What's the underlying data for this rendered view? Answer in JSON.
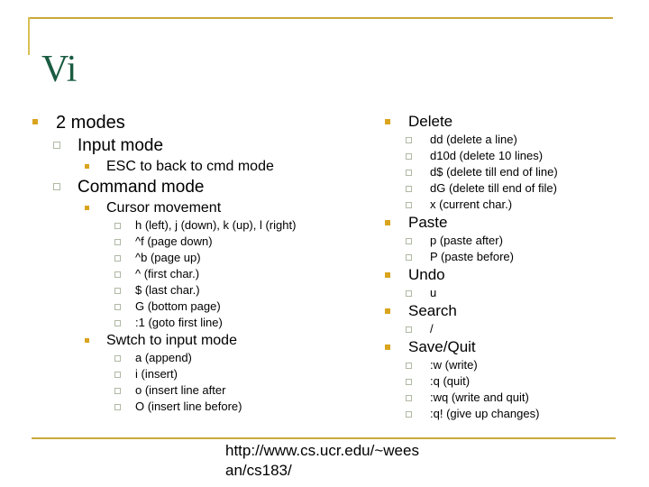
{
  "slide": {
    "title": "Vi",
    "title_color": "#1a5c42",
    "accent_color": "#c9a93a",
    "bullet_filled_color": "#d9a41e",
    "bullet_hollow_border_color": "#aeb9a4",
    "background_color": "#ffffff"
  },
  "left_column": [
    {
      "level": 1,
      "bullet": "filled-square",
      "text": "2 modes"
    },
    {
      "level": 2,
      "bullet": "hollow-square",
      "text": "Input mode"
    },
    {
      "level": 3,
      "bullet": "filled-square",
      "text": "ESC to back to cmd mode"
    },
    {
      "level": 2,
      "bullet": "hollow-square",
      "text": "Command mode"
    },
    {
      "level": 3,
      "bullet": "filled-square",
      "text": "Cursor movement"
    },
    {
      "level": 4,
      "bullet": "hollow-square",
      "text": "h (left), j (down), k (up), l (right)"
    },
    {
      "level": 4,
      "bullet": "hollow-square",
      "text": "^f (page down)"
    },
    {
      "level": 4,
      "bullet": "hollow-square",
      "text": "^b (page up)"
    },
    {
      "level": 4,
      "bullet": "hollow-square",
      "text": "^ (first char.)"
    },
    {
      "level": 4,
      "bullet": "hollow-square",
      "text": "$ (last char.)"
    },
    {
      "level": 4,
      "bullet": "hollow-square",
      "text": "G (bottom page)"
    },
    {
      "level": 4,
      "bullet": "hollow-square",
      "text": ":1 (goto first line)"
    },
    {
      "level": 3,
      "bullet": "filled-square",
      "text": "Swtch to input mode"
    },
    {
      "level": 4,
      "bullet": "hollow-square",
      "text": "a (append)"
    },
    {
      "level": 4,
      "bullet": "hollow-square",
      "text": "i (insert)"
    },
    {
      "level": 4,
      "bullet": "hollow-square",
      "text": "o (insert line after"
    },
    {
      "level": 4,
      "bullet": "hollow-square",
      "text": "O (insert line before)"
    }
  ],
  "right_column": [
    {
      "level": 1,
      "bullet": "filled-square",
      "text": "Delete"
    },
    {
      "level": 2,
      "bullet": "hollow-square",
      "text": "dd (delete a line)"
    },
    {
      "level": 2,
      "bullet": "hollow-square",
      "text": "d10d (delete 10 lines)"
    },
    {
      "level": 2,
      "bullet": "hollow-square",
      "text": "d$ (delete till end of line)"
    },
    {
      "level": 2,
      "bullet": "hollow-square",
      "text": "dG (delete till end of file)"
    },
    {
      "level": 2,
      "bullet": "hollow-square",
      "text": "x (current char.)"
    },
    {
      "level": 1,
      "bullet": "filled-square",
      "text": "Paste"
    },
    {
      "level": 2,
      "bullet": "hollow-square",
      "text": "p (paste after)"
    },
    {
      "level": 2,
      "bullet": "hollow-square",
      "text": "P (paste before)"
    },
    {
      "level": 1,
      "bullet": "filled-square",
      "text": "Undo"
    },
    {
      "level": 2,
      "bullet": "hollow-square",
      "text": "u"
    },
    {
      "level": 1,
      "bullet": "filled-square",
      "text": "Search"
    },
    {
      "level": 2,
      "bullet": "hollow-square",
      "text": "/"
    },
    {
      "level": 1,
      "bullet": "filled-square",
      "text": "Save/Quit"
    },
    {
      "level": 2,
      "bullet": "hollow-square",
      "text": ":w (write)"
    },
    {
      "level": 2,
      "bullet": "hollow-square",
      "text": ":q (quit)"
    },
    {
      "level": 2,
      "bullet": "hollow-square",
      "text": ":wq (write and quit)"
    },
    {
      "level": 2,
      "bullet": "hollow-square",
      "text": ":q! (give up changes)"
    }
  ],
  "footer": {
    "url": "http://www.cs.ucr.edu/~weesan/cs183/"
  }
}
